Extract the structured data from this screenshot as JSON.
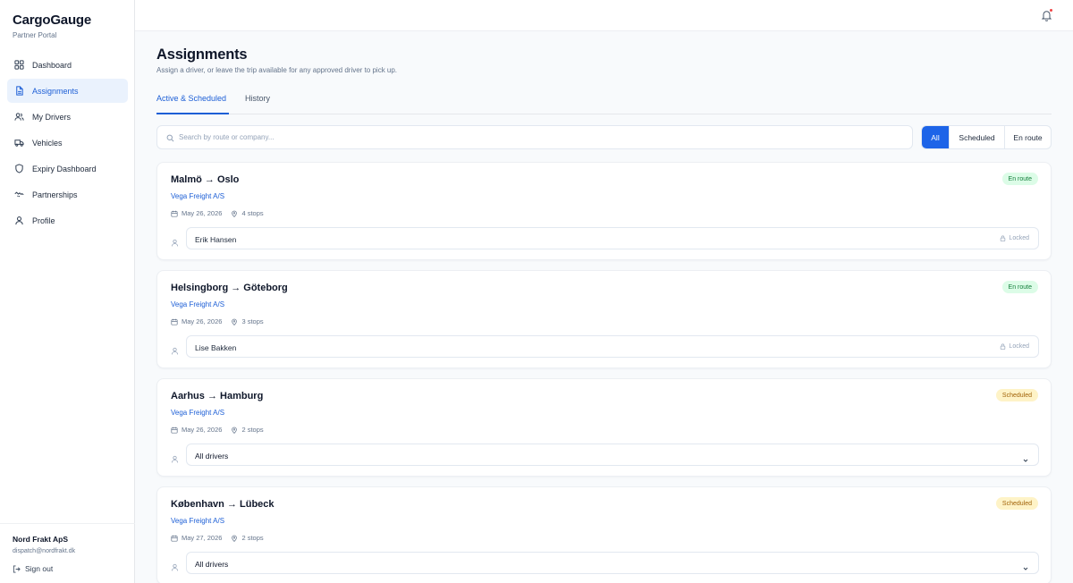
{
  "brand": {
    "name": "CargoGauge",
    "subtitle": "Partner Portal"
  },
  "nav": [
    {
      "label": "Dashboard",
      "icon": "grid-icon",
      "active": false
    },
    {
      "label": "Assignments",
      "icon": "document-icon",
      "active": true
    },
    {
      "label": "My Drivers",
      "icon": "users-icon",
      "active": false
    },
    {
      "label": "Vehicles",
      "icon": "truck-icon",
      "active": false
    },
    {
      "label": "Expiry Dashboard",
      "icon": "shield-icon",
      "active": false
    },
    {
      "label": "Partnerships",
      "icon": "handshake-icon",
      "active": false
    },
    {
      "label": "Profile",
      "icon": "user-icon",
      "active": false
    }
  ],
  "account": {
    "name": "Nord Frakt ApS",
    "email": "dispatch@nordfrakt.dk",
    "signout_label": "Sign out"
  },
  "page": {
    "title": "Assignments",
    "subtitle": "Assign a driver, or leave the trip available for any approved driver to pick up."
  },
  "tabs": [
    {
      "label": "Active & Scheduled",
      "active": true
    },
    {
      "label": "History",
      "active": false
    }
  ],
  "search": {
    "placeholder": "Search by route or company...",
    "value": ""
  },
  "filters": [
    {
      "label": "All",
      "active": true
    },
    {
      "label": "Scheduled",
      "active": false
    },
    {
      "label": "En route",
      "active": false
    }
  ],
  "colors": {
    "accent": "#1d64e8",
    "enroute_bg": "#dcfce7",
    "enroute_fg": "#15803d",
    "scheduled_bg": "#fef3c7",
    "scheduled_fg": "#a16207"
  },
  "trips": [
    {
      "route": "Malmö → Oslo",
      "company": "Vega Freight A/S",
      "date": "May 26, 2026",
      "stops": "4 stops",
      "status": "En route",
      "status_kind": "enroute",
      "driver": "Erik Hansen",
      "locked": true,
      "locked_label": "Locked"
    },
    {
      "route": "Helsingborg → Göteborg",
      "company": "Vega Freight A/S",
      "date": "May 26, 2026",
      "stops": "3 stops",
      "status": "En route",
      "status_kind": "enroute",
      "driver": "Lise Bakken",
      "locked": true,
      "locked_label": "Locked"
    },
    {
      "route": "Aarhus → Hamburg",
      "company": "Vega Freight A/S",
      "date": "May 26, 2026",
      "stops": "2 stops",
      "status": "Scheduled",
      "status_kind": "scheduled",
      "driver": "All drivers",
      "locked": false
    },
    {
      "route": "København → Lübeck",
      "company": "Vega Freight A/S",
      "date": "May 27, 2026",
      "stops": "2 stops",
      "status": "Scheduled",
      "status_kind": "scheduled",
      "driver": "All drivers",
      "locked": false
    }
  ]
}
